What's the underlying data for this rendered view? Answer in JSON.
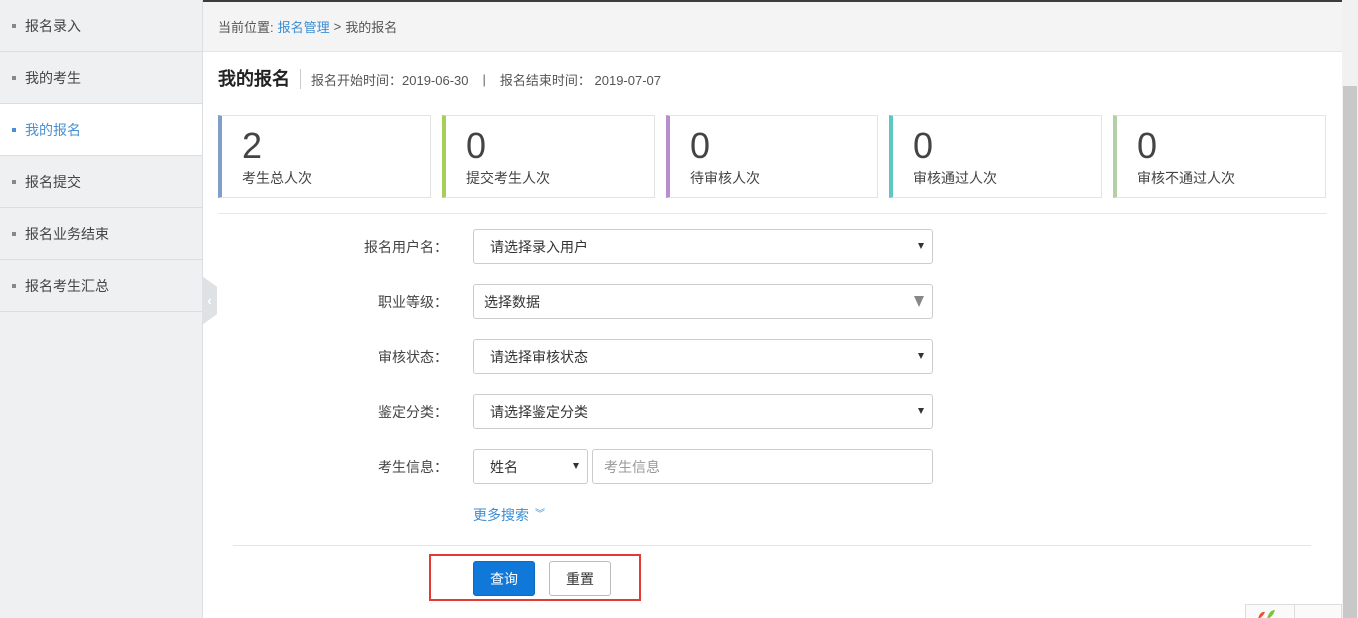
{
  "sidebar": {
    "items": [
      {
        "label": "报名录入",
        "active": false
      },
      {
        "label": "我的考生",
        "active": false
      },
      {
        "label": "我的报名",
        "active": true
      },
      {
        "label": "报名提交",
        "active": false
      },
      {
        "label": "报名业务结束",
        "active": false
      },
      {
        "label": "报名考生汇总",
        "active": false
      }
    ],
    "collapse_icon": "chevron-left-icon"
  },
  "breadcrumb": {
    "prefix": "当前位置:",
    "link": "报名管理",
    "separator": ">",
    "current": "我的报名"
  },
  "header": {
    "title": "我的报名",
    "start_label": "报名开始时间：2019-06-30",
    "divider": "|",
    "end_label": "报名结束时间： 2019-07-07"
  },
  "stats": [
    {
      "value": "2",
      "label": "考生总人次",
      "color": "#7f9fc9"
    },
    {
      "value": "0",
      "label": "提交考生人次",
      "color": "#a6cf5a"
    },
    {
      "value": "0",
      "label": "待审核人次",
      "color": "#b88fcc"
    },
    {
      "value": "0",
      "label": "审核通过人次",
      "color": "#5ec7c2"
    },
    {
      "value": "0",
      "label": "审核不通过人次",
      "color": "#b3cfa6"
    }
  ],
  "form": {
    "user_label": "报名用户名：",
    "user_value": "请选择录入用户",
    "level_label": "职业等级：",
    "level_value": "选择数据",
    "status_label": "审核状态：",
    "status_value": "请选择审核状态",
    "category_label": "鉴定分类：",
    "category_value": "请选择鉴定分类",
    "info_label": "考生信息：",
    "info_type_value": "姓名",
    "info_placeholder": "考生信息",
    "more_label": "更多搜索",
    "more_icon": "double-chevron-down-icon"
  },
  "actions": {
    "query_label": "查询",
    "reset_label": "重置",
    "highlight_color": "#e53935"
  }
}
